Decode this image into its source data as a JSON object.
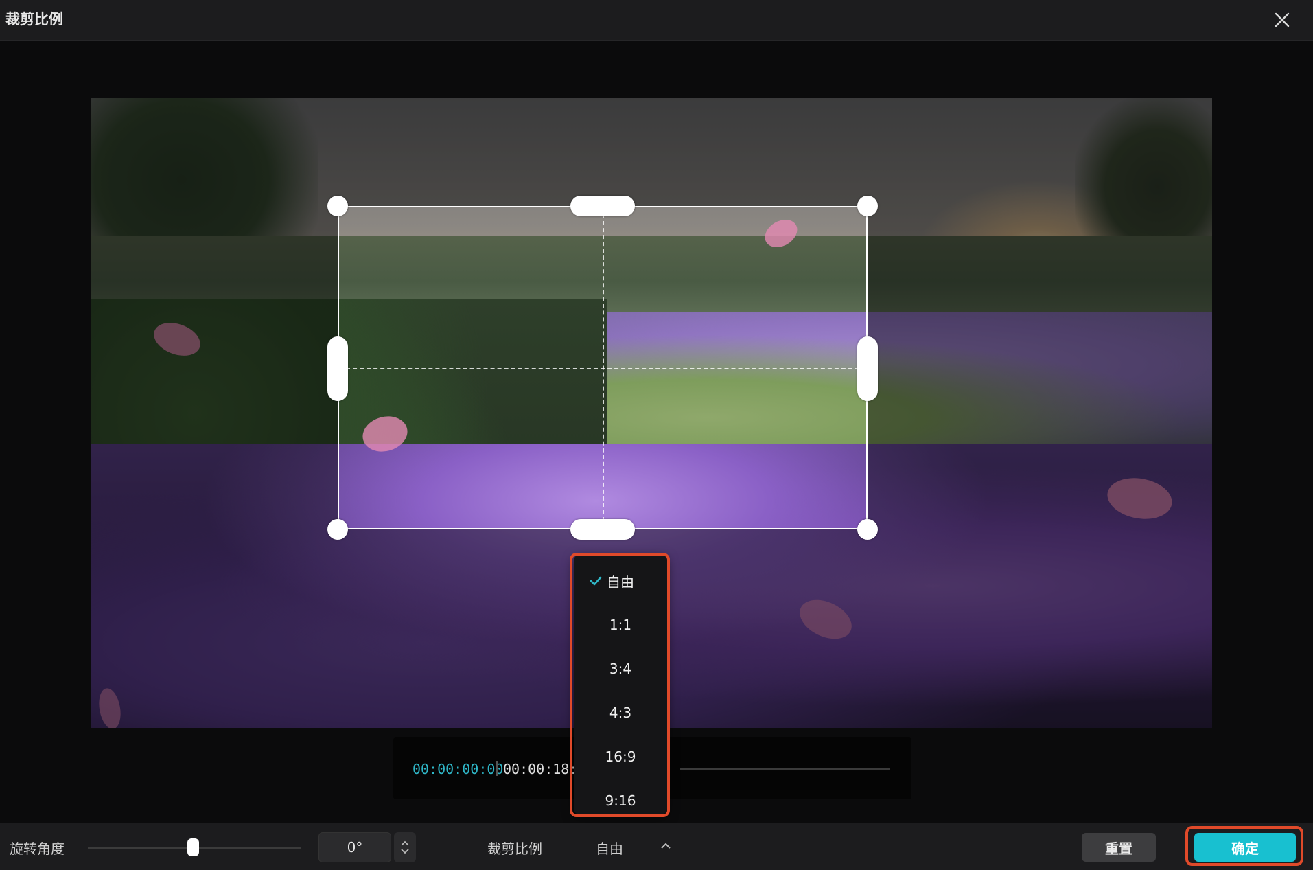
{
  "window": {
    "title": "裁剪比例",
    "close_icon": "close-icon"
  },
  "timeline": {
    "current_time": "00:00:00:00",
    "total_time": "00:00:18:"
  },
  "dropdown": {
    "items": [
      {
        "label": "自由",
        "selected": true
      },
      {
        "label": "1:1",
        "selected": false
      },
      {
        "label": "3:4",
        "selected": false
      },
      {
        "label": "4:3",
        "selected": false
      },
      {
        "label": "16:9",
        "selected": false
      },
      {
        "label": "9:16",
        "selected": false
      }
    ]
  },
  "bottom": {
    "rotation_label": "旋转角度",
    "rotation_value": "0°",
    "crop_ratio_label": "裁剪比例",
    "crop_ratio_value": "自由",
    "reset_label": "重置",
    "confirm_label": "确定"
  },
  "colors": {
    "accent": "#18c0d0",
    "timecode": "#2fb7c8",
    "highlight": "#e04a2a"
  }
}
